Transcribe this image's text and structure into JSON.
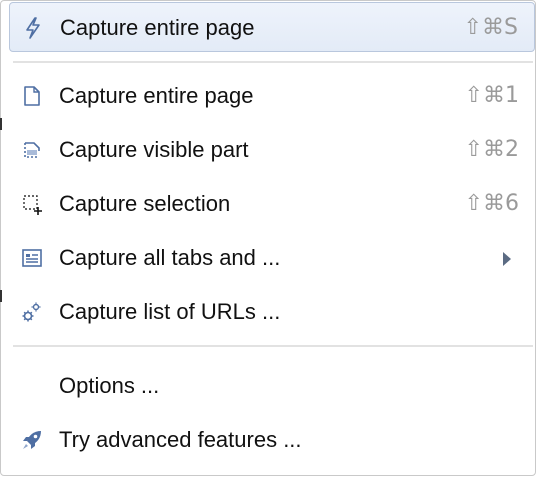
{
  "menu": {
    "top_item": {
      "icon": "lightning-icon",
      "label": "Capture entire page",
      "shortcut": "⇧⌘S"
    },
    "items": [
      {
        "icon": "page-icon",
        "label": "Capture entire page",
        "shortcut": "⇧⌘1"
      },
      {
        "icon": "visible-part-icon",
        "label": "Capture visible part",
        "shortcut": "⇧⌘2"
      },
      {
        "icon": "selection-icon",
        "label": "Capture selection",
        "shortcut": "⇧⌘6"
      },
      {
        "icon": "tabs-icon",
        "label": "Capture all tabs and ...",
        "submenu": true
      },
      {
        "icon": "gears-icon",
        "label": "Capture list of URLs ..."
      }
    ],
    "footer_items": [
      {
        "label": "Options ..."
      },
      {
        "icon": "rocket-icon",
        "label": "Try advanced features ..."
      }
    ]
  },
  "colors": {
    "highlight_bg": "#e3ebf7",
    "icon_blue": "#4f6fa3",
    "shortcut_gray": "#9a9a9a"
  }
}
